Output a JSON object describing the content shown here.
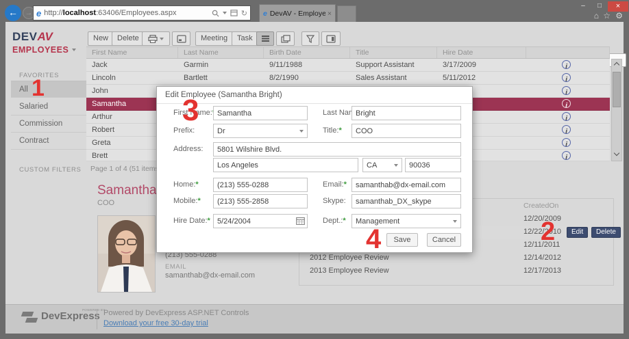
{
  "browser": {
    "url_prefix": "http://",
    "url_host": "localhost",
    "url_path": ":63406/Employees.aspx",
    "tab_title": "DevAV - Employees"
  },
  "icons": {
    "minimize": "–",
    "maximize": "□",
    "close": "×",
    "tab_close": "×",
    "home": "⌂",
    "favorites_star": "☆",
    "settings_gear": "⚙",
    "refresh": "↻",
    "ie_logo": "e",
    "info": "i",
    "back_arrow": "←",
    "forward_arrow": "→"
  },
  "sidebar": {
    "logo_main": "DEV",
    "logo_accent": "AV",
    "logo_sub": "EMPLOYEES",
    "favorites_header": "FAVORITES",
    "items": [
      {
        "label": "All"
      },
      {
        "label": "Salaried"
      },
      {
        "label": "Commission"
      },
      {
        "label": "Contract"
      }
    ],
    "custom_filters_header": "CUSTOM FILTERS"
  },
  "toolbar": {
    "new_label": "New",
    "delete_label": "Delete",
    "meeting_label": "Meeting",
    "task_label": "Task"
  },
  "grid": {
    "columns": [
      "First Name",
      "Last Name",
      "Birth Date",
      "Title",
      "Hire Date"
    ],
    "rows": [
      {
        "first": "Jack",
        "last": "Garmin",
        "birth": "9/11/1988",
        "title": "Support Assistant",
        "hire": "3/17/2009"
      },
      {
        "first": "Lincoln",
        "last": "Bartlett",
        "birth": "8/2/1990",
        "title": "Sales Assistant",
        "hire": "5/11/2012"
      },
      {
        "first": "John",
        "last": "",
        "birth": "",
        "title": "",
        "hire": ""
      },
      {
        "first": "Samantha",
        "last": "",
        "birth": "",
        "title": "",
        "hire": ""
      },
      {
        "first": "Arthur",
        "last": "",
        "birth": "",
        "title": "",
        "hire": ""
      },
      {
        "first": "Robert",
        "last": "",
        "birth": "",
        "title": "",
        "hire": ""
      },
      {
        "first": "Greta",
        "last": "",
        "birth": "",
        "title": "",
        "hire": ""
      },
      {
        "first": "Brett",
        "last": "",
        "birth": "",
        "title": "",
        "hire": ""
      }
    ],
    "pager": "Page 1 of 4 (51 items)"
  },
  "detail": {
    "name": "Samantha Bright",
    "job_title": "COO",
    "phone": "(213) 555-0288",
    "email_label": "EMAIL",
    "email": "samanthab@dx-email.com",
    "evaluations": {
      "created_on_header": "CreatedOn",
      "edit_label": "Edit",
      "delete_label": "Delete",
      "rows": [
        {
          "name": "",
          "date": "12/20/2009"
        },
        {
          "name": "",
          "date": "12/22/2010"
        },
        {
          "name": "",
          "date": "12/11/2011"
        },
        {
          "name": "2012 Employee Review",
          "date": "12/14/2012"
        },
        {
          "name": "2013 Employee Review",
          "date": "12/17/2013"
        }
      ]
    }
  },
  "modal": {
    "title": "Edit Employee (Samantha Bright)",
    "required_mark": "*",
    "fields": {
      "first_name": {
        "label": "First Name:",
        "value": "Samantha"
      },
      "last_name": {
        "label": "Last Name:",
        "value": "Bright"
      },
      "prefix": {
        "label": "Prefix:",
        "value": "Dr"
      },
      "job_title": {
        "label": "Title:",
        "value": "COO"
      },
      "address": {
        "label": "Address:",
        "value": "5801 Wilshire Blvd."
      },
      "city": {
        "value": "Los Angeles"
      },
      "state": {
        "value": "CA"
      },
      "zip": {
        "value": "90036"
      },
      "home": {
        "label": "Home:",
        "value": "(213) 555-0288"
      },
      "email": {
        "label": "Email:",
        "value": "samanthab@dx-email.com"
      },
      "mobile": {
        "label": "Mobile:",
        "value": "(213) 555-2858"
      },
      "skype": {
        "label": "Skype:",
        "value": "samanthab_DX_skype"
      },
      "hire_date": {
        "label": "Hire Date:",
        "value": "5/24/2004"
      },
      "dept": {
        "label": "Dept.:",
        "value": "Management"
      }
    },
    "save_label": "Save",
    "cancel_label": "Cancel"
  },
  "footer": {
    "logo_text": "DevExpress",
    "logo_sup": "POWERED BY",
    "powered_text": "Powered by DevExpress ASP.NET Controls",
    "link_text": "Download your free 30-day trial"
  },
  "annotations": {
    "n1": "1",
    "n2": "2",
    "n3": "3",
    "n4": "4"
  },
  "colors": {
    "selection": "#9c3453",
    "accent_red": "#b5344c",
    "navy": "#33415c",
    "annotation_red": "#e33330",
    "action_button": "#3d4c70",
    "link_blue": "#4a7db5",
    "required_green": "#3f9c3f",
    "info_icon_blue": "#5565a8"
  }
}
